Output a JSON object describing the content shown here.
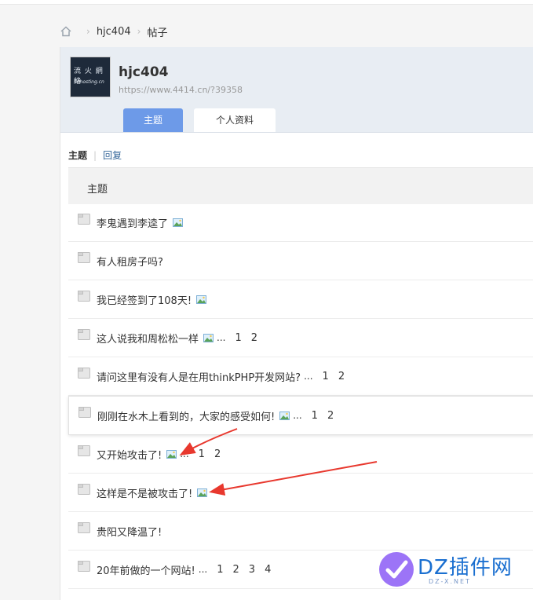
{
  "breadcrumb": {
    "user": "hjc404",
    "current": "帖子"
  },
  "profile": {
    "name": "hjc404",
    "url": "https://www.4414.cn/?39358",
    "avatar_line1": "流 火 網 絡",
    "avatar_line2": "flohosting.cn"
  },
  "tabs": [
    {
      "label": "主题"
    },
    {
      "label": "个人资料"
    }
  ],
  "filter": {
    "active": "主题",
    "other": "回复"
  },
  "table_header": "主题",
  "threads": [
    {
      "title": "李鬼遇到李逵了",
      "has_image": true,
      "pages": []
    },
    {
      "title": "有人租房子吗?",
      "has_image": false,
      "pages": []
    },
    {
      "title": "我已经签到了108天!",
      "has_image": true,
      "pages": []
    },
    {
      "title": "这人说我和周松松一样",
      "has_image": true,
      "ellipsis": "...",
      "pages": [
        "1",
        "2"
      ]
    },
    {
      "title": "请问这里有没有人是在用thinkPHP开发网站?",
      "has_image": false,
      "ellipsis": "...",
      "pages": [
        "1",
        "2"
      ]
    },
    {
      "title": "刚刚在水木上看到的，大家的感受如何!",
      "has_image": true,
      "ellipsis": "...",
      "pages": [
        "1",
        "2"
      ]
    },
    {
      "title": "又开始攻击了!",
      "has_image": true,
      "ellipsis": "...",
      "pages": [
        "1",
        "2"
      ]
    },
    {
      "title": "这样是不是被攻击了!",
      "has_image": true,
      "pages": []
    },
    {
      "title": "贵阳又降温了!",
      "has_image": false,
      "pages": []
    },
    {
      "title": "20年前做的一个网站!",
      "has_image": false,
      "ellipsis": "...",
      "pages": [
        "1",
        "2",
        "3",
        "4"
      ]
    }
  ],
  "watermark": {
    "brand": "DZ插件网",
    "domain": "DZ-X.NET"
  },
  "colors": {
    "accent": "#6d9ae8",
    "link": "#336699",
    "arrow": "#e8382e"
  }
}
